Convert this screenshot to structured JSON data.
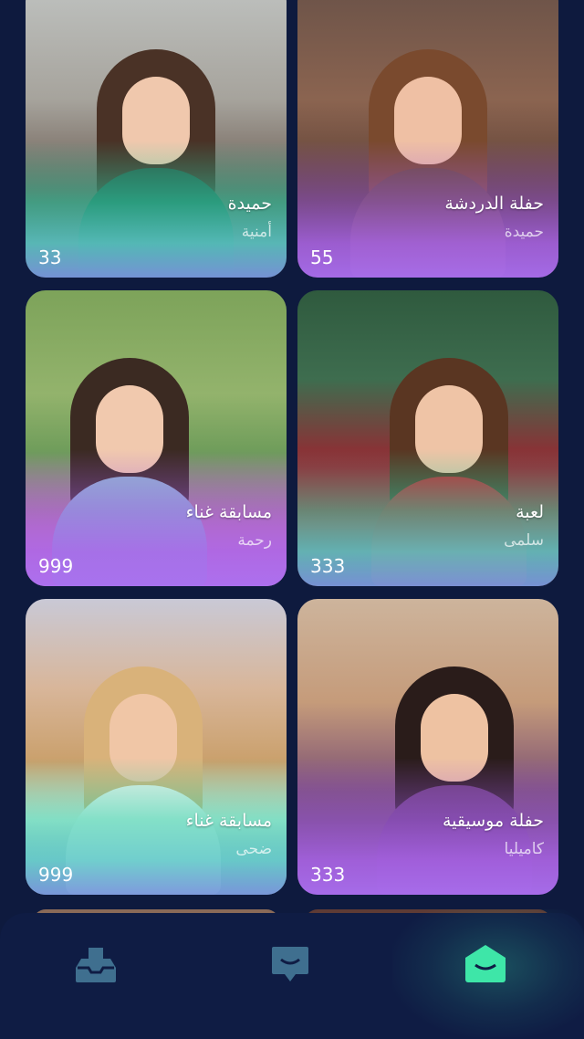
{
  "cards": [
    {
      "title": "حميدة",
      "subtitle": "أمنية",
      "count": "33",
      "theme": "green"
    },
    {
      "title": "حفلة الدردشة",
      "subtitle": "حميدة",
      "count": "55",
      "theme": "purple"
    },
    {
      "title": "مسابقة غناء",
      "subtitle": "رحمة",
      "count": "999",
      "theme": "purple"
    },
    {
      "title": "لعبة",
      "subtitle": "سلمى",
      "count": "333",
      "theme": "green"
    },
    {
      "title": "مسابقة غناء",
      "subtitle": "ضحى",
      "count": "999",
      "theme": "green"
    },
    {
      "title": "حفلة موسيقية",
      "subtitle": "كاميليا",
      "count": "333",
      "theme": "purple"
    }
  ],
  "nav": {
    "items": [
      {
        "icon": "inbox-tray-icon"
      },
      {
        "icon": "chat-bubble-icon"
      },
      {
        "icon": "home-icon"
      }
    ],
    "active_index": 2
  },
  "colors": {
    "background": "#0e1a3e",
    "nav_background": "#0f1c44",
    "active_icon": "#3ee6a8",
    "inactive_icon": "#3f6f8f"
  }
}
